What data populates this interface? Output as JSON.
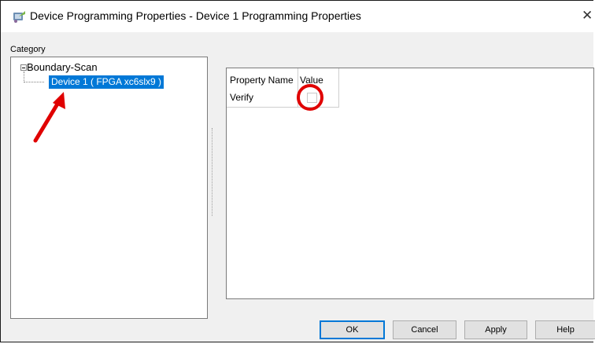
{
  "window": {
    "title": "Device Programming Properties - Device 1 Programming Properties",
    "close_glyph": "✕"
  },
  "category": {
    "label": "Category",
    "tree": {
      "root": "Boundary-Scan",
      "child": "Device 1 ( FPGA xc6slx9 )"
    }
  },
  "grid": {
    "headers": [
      "Property Name",
      "Value"
    ],
    "rows": [
      {
        "name": "Verify",
        "value_checked": false
      }
    ]
  },
  "buttons": {
    "ok": "OK",
    "cancel": "Cancel",
    "apply": "Apply",
    "help": "Help"
  },
  "annotations": {
    "arrow_color": "#e00000",
    "circle_color": "#e00000"
  },
  "colors": {
    "selection": "#0078d7",
    "dialog_bg": "#f0f0f0"
  }
}
